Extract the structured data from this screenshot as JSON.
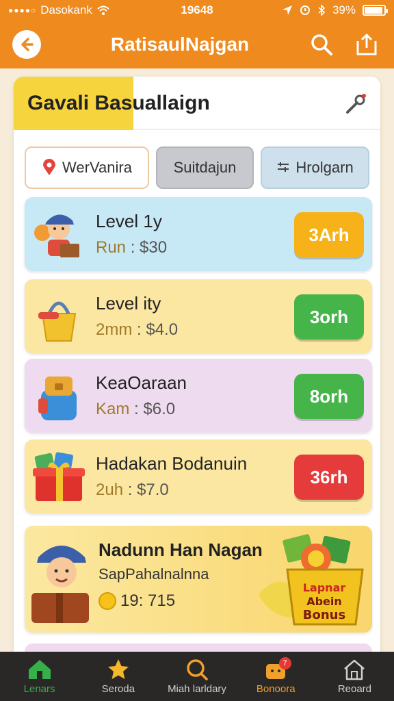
{
  "status_bar": {
    "carrier": "Dasokank",
    "time": "19648",
    "battery": "39%"
  },
  "header": {
    "title": "RatisaulNajgan",
    "back_icon": "arrow-left-icon",
    "search_icon": "search-icon",
    "share_icon": "share-icon"
  },
  "banner": {
    "title": "Gavali Basuallaign"
  },
  "filters": {
    "location": "WerVanira",
    "sort": "Suitdajun",
    "filter": "Hrolgarn"
  },
  "items": [
    {
      "name": "Level 1y",
      "price_label": "Run",
      "price": "$30",
      "button": "3Arh",
      "color": "#c7e8f5",
      "button_color": "#f7b21a"
    },
    {
      "name": "Level ity",
      "price_label": "2mm",
      "price": "$4.0",
      "button": "3orh",
      "color": "#fbe7a2",
      "button_color": "#45b54a"
    },
    {
      "name": "KeaOaraan",
      "price_label": "Kam",
      "price": "$6.0",
      "button": "8orh",
      "color": "#efdbef",
      "button_color": "#45b54a"
    },
    {
      "name": "Hadakan Bodanuin",
      "price_label": "2uh",
      "price": "$7.0",
      "button": "36rh",
      "color": "#fbe7a2",
      "button_color": "#e53b3b"
    }
  ],
  "promo": {
    "title": "Nadunn Han Nagan",
    "subtitle": "SapPahalnalnna",
    "timer": "19: 715",
    "bonus_text": "Lapnar Abein Bonus"
  },
  "bottom_nav": [
    {
      "label": "Lenars",
      "icon": "home-icon"
    },
    {
      "label": "Seroda",
      "icon": "star-icon"
    },
    {
      "label": "Miah larldary",
      "icon": "search-icon"
    },
    {
      "label": "Bonoora",
      "icon": "gift-icon",
      "badge": "7"
    },
    {
      "label": "Reoard",
      "icon": "house-icon"
    }
  ]
}
